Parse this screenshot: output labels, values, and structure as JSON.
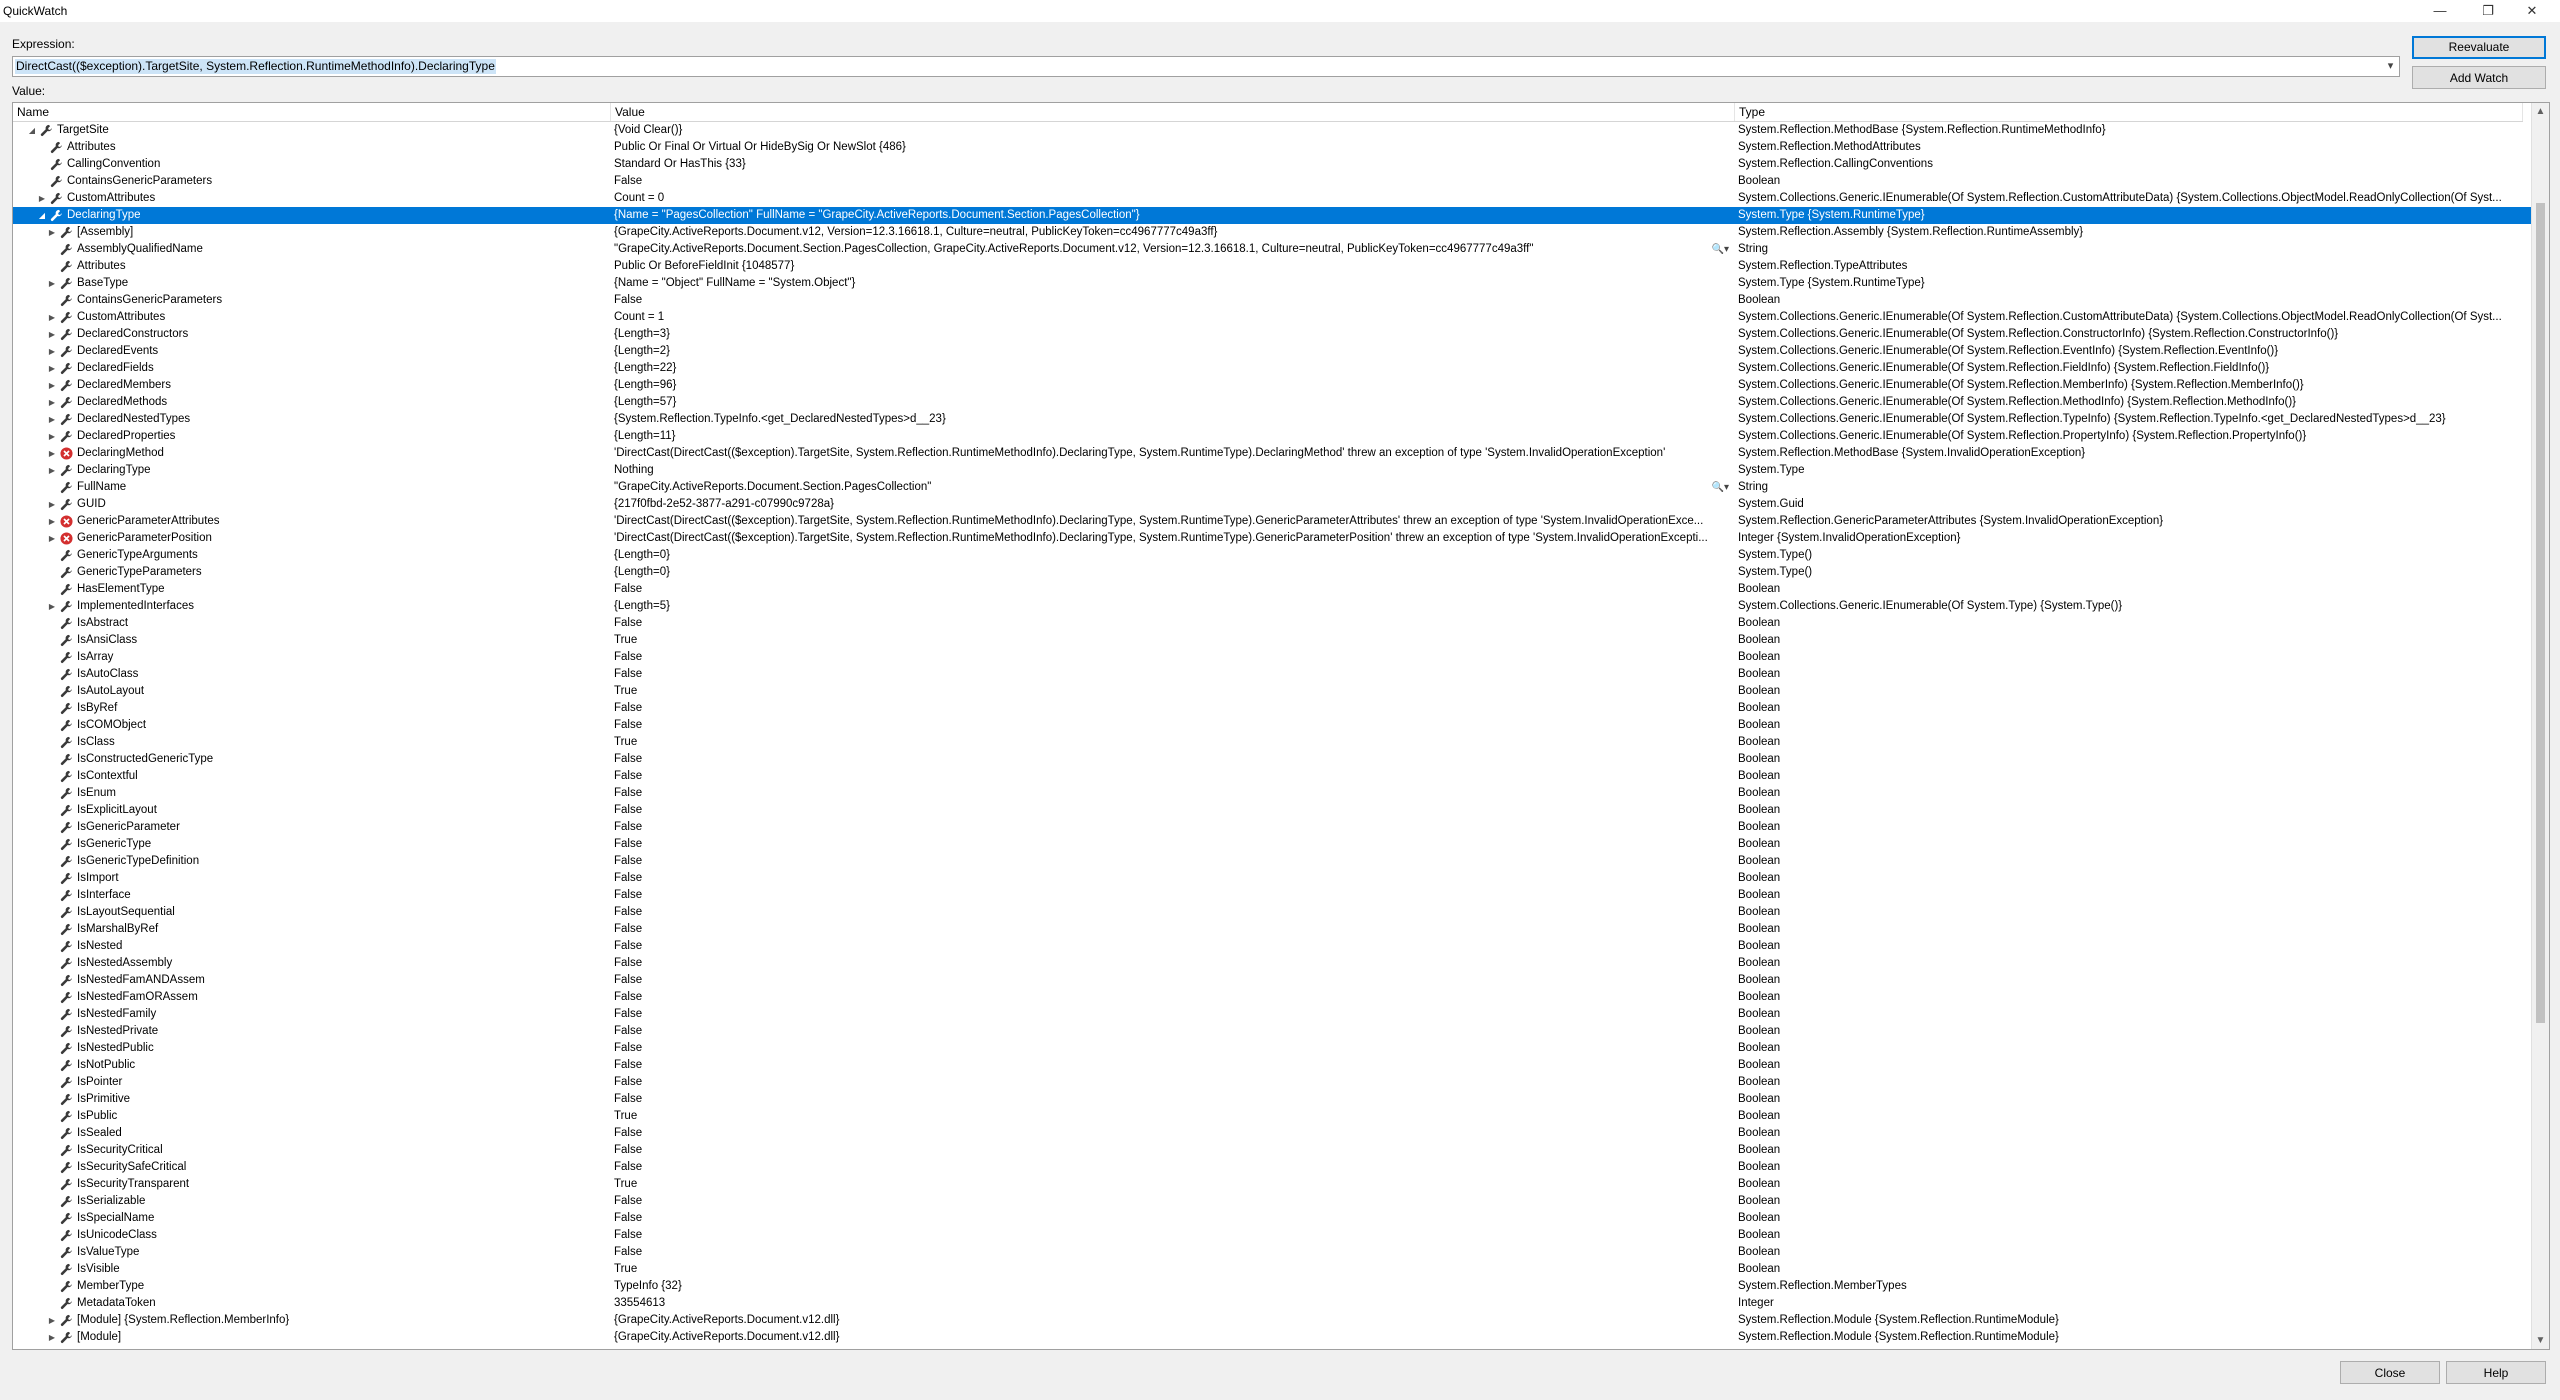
{
  "window": {
    "title": "QuickWatch",
    "controls": {
      "minimize": "—",
      "maximize": "❐",
      "close": "✕"
    }
  },
  "expression": {
    "label": "Expression:",
    "value": "DirectCast(($exception).TargetSite, System.Reflection.RuntimeMethodInfo).DeclaringType"
  },
  "value_label": "Value:",
  "buttons": {
    "reevaluate": "Reevaluate",
    "add_watch": "Add Watch",
    "close": "Close",
    "help": "Help"
  },
  "columns": {
    "name": "Name",
    "value": "Value",
    "type": "Type"
  },
  "rows": [
    {
      "level": 1,
      "exp": "collapse",
      "icon": "wrench",
      "name": "TargetSite",
      "value": "{Void Clear()}",
      "type": "System.Reflection.MethodBase {System.Reflection.RuntimeMethodInfo}"
    },
    {
      "level": 2,
      "exp": "",
      "icon": "wrench",
      "name": "Attributes",
      "value": "Public Or Final Or Virtual Or HideBySig Or NewSlot {486}",
      "type": "System.Reflection.MethodAttributes"
    },
    {
      "level": 2,
      "exp": "",
      "icon": "wrench",
      "name": "CallingConvention",
      "value": "Standard Or HasThis {33}",
      "type": "System.Reflection.CallingConventions"
    },
    {
      "level": 2,
      "exp": "",
      "icon": "wrench",
      "name": "ContainsGenericParameters",
      "value": "False",
      "type": "Boolean"
    },
    {
      "level": 2,
      "exp": "expand",
      "icon": "wrench",
      "name": "CustomAttributes",
      "value": "Count = 0",
      "type": "System.Collections.Generic.IEnumerable(Of System.Reflection.CustomAttributeData) {System.Collections.ObjectModel.ReadOnlyCollection(Of Syst..."
    },
    {
      "level": 2,
      "exp": "collapse",
      "icon": "wrench",
      "name": "DeclaringType",
      "value": "{Name = \"PagesCollection\" FullName = \"GrapeCity.ActiveReports.Document.Section.PagesCollection\"}",
      "type": "System.Type {System.RuntimeType}",
      "selected": true
    },
    {
      "level": 3,
      "exp": "expand",
      "icon": "wrench",
      "name": "[Assembly]",
      "value": "{GrapeCity.ActiveReports.Document.v12, Version=12.3.16618.1, Culture=neutral, PublicKeyToken=cc4967777c49a3ff}",
      "type": "System.Reflection.Assembly {System.Reflection.RuntimeAssembly}"
    },
    {
      "level": 3,
      "exp": "",
      "icon": "wrench",
      "name": "AssemblyQualifiedName",
      "value": "\"GrapeCity.ActiveReports.Document.Section.PagesCollection, GrapeCity.ActiveReports.Document.v12, Version=12.3.16618.1, Culture=neutral, PublicKeyToken=cc4967777c49a3ff\"",
      "type": "String",
      "mag": "🔍▾"
    },
    {
      "level": 3,
      "exp": "",
      "icon": "wrench",
      "name": "Attributes",
      "value": "Public Or BeforeFieldInit {1048577}",
      "type": "System.Reflection.TypeAttributes"
    },
    {
      "level": 3,
      "exp": "expand",
      "icon": "wrench",
      "name": "BaseType",
      "value": "{Name = \"Object\" FullName = \"System.Object\"}",
      "type": "System.Type {System.RuntimeType}"
    },
    {
      "level": 3,
      "exp": "",
      "icon": "wrench",
      "name": "ContainsGenericParameters",
      "value": "False",
      "type": "Boolean"
    },
    {
      "level": 3,
      "exp": "expand",
      "icon": "wrench",
      "name": "CustomAttributes",
      "value": "Count = 1",
      "type": "System.Collections.Generic.IEnumerable(Of System.Reflection.CustomAttributeData) {System.Collections.ObjectModel.ReadOnlyCollection(Of Syst..."
    },
    {
      "level": 3,
      "exp": "expand",
      "icon": "wrench",
      "name": "DeclaredConstructors",
      "value": "{Length=3}",
      "type": "System.Collections.Generic.IEnumerable(Of System.Reflection.ConstructorInfo) {System.Reflection.ConstructorInfo()}"
    },
    {
      "level": 3,
      "exp": "expand",
      "icon": "wrench",
      "name": "DeclaredEvents",
      "value": "{Length=2}",
      "type": "System.Collections.Generic.IEnumerable(Of System.Reflection.EventInfo) {System.Reflection.EventInfo()}"
    },
    {
      "level": 3,
      "exp": "expand",
      "icon": "wrench",
      "name": "DeclaredFields",
      "value": "{Length=22}",
      "type": "System.Collections.Generic.IEnumerable(Of System.Reflection.FieldInfo) {System.Reflection.FieldInfo()}"
    },
    {
      "level": 3,
      "exp": "expand",
      "icon": "wrench",
      "name": "DeclaredMembers",
      "value": "{Length=96}",
      "type": "System.Collections.Generic.IEnumerable(Of System.Reflection.MemberInfo) {System.Reflection.MemberInfo()}"
    },
    {
      "level": 3,
      "exp": "expand",
      "icon": "wrench",
      "name": "DeclaredMethods",
      "value": "{Length=57}",
      "type": "System.Collections.Generic.IEnumerable(Of System.Reflection.MethodInfo) {System.Reflection.MethodInfo()}"
    },
    {
      "level": 3,
      "exp": "expand",
      "icon": "wrench",
      "name": "DeclaredNestedTypes",
      "value": "{System.Reflection.TypeInfo.<get_DeclaredNestedTypes>d__23}",
      "type": "System.Collections.Generic.IEnumerable(Of System.Reflection.TypeInfo) {System.Reflection.TypeInfo.<get_DeclaredNestedTypes>d__23}"
    },
    {
      "level": 3,
      "exp": "expand",
      "icon": "wrench",
      "name": "DeclaredProperties",
      "value": "{Length=11}",
      "type": "System.Collections.Generic.IEnumerable(Of System.Reflection.PropertyInfo) {System.Reflection.PropertyInfo()}"
    },
    {
      "level": 3,
      "exp": "expand",
      "icon": "error",
      "name": "DeclaringMethod",
      "value": "'DirectCast(DirectCast(($exception).TargetSite, System.Reflection.RuntimeMethodInfo).DeclaringType, System.RuntimeType).DeclaringMethod' threw an exception of type 'System.InvalidOperationException'",
      "type": "System.Reflection.MethodBase {System.InvalidOperationException}"
    },
    {
      "level": 3,
      "exp": "expand",
      "icon": "wrench",
      "name": "DeclaringType",
      "value": "Nothing",
      "type": "System.Type"
    },
    {
      "level": 3,
      "exp": "",
      "icon": "wrench",
      "name": "FullName",
      "value": "\"GrapeCity.ActiveReports.Document.Section.PagesCollection\"",
      "type": "String",
      "mag": "🔍▾"
    },
    {
      "level": 3,
      "exp": "expand",
      "icon": "wrench",
      "name": "GUID",
      "value": "{217f0fbd-2e52-3877-a291-c07990c9728a}",
      "type": "System.Guid"
    },
    {
      "level": 3,
      "exp": "expand",
      "icon": "error",
      "name": "GenericParameterAttributes",
      "value": "'DirectCast(DirectCast(($exception).TargetSite, System.Reflection.RuntimeMethodInfo).DeclaringType, System.RuntimeType).GenericParameterAttributes' threw an exception of type 'System.InvalidOperationExce...",
      "type": "System.Reflection.GenericParameterAttributes {System.InvalidOperationException}"
    },
    {
      "level": 3,
      "exp": "expand",
      "icon": "error",
      "name": "GenericParameterPosition",
      "value": "'DirectCast(DirectCast(($exception).TargetSite, System.Reflection.RuntimeMethodInfo).DeclaringType, System.RuntimeType).GenericParameterPosition' threw an exception of type 'System.InvalidOperationExcepti...",
      "type": "Integer {System.InvalidOperationException}"
    },
    {
      "level": 3,
      "exp": "",
      "icon": "wrench",
      "name": "GenericTypeArguments",
      "value": "{Length=0}",
      "type": "System.Type()"
    },
    {
      "level": 3,
      "exp": "",
      "icon": "wrench",
      "name": "GenericTypeParameters",
      "value": "{Length=0}",
      "type": "System.Type()"
    },
    {
      "level": 3,
      "exp": "",
      "icon": "wrench",
      "name": "HasElementType",
      "value": "False",
      "type": "Boolean"
    },
    {
      "level": 3,
      "exp": "expand",
      "icon": "wrench",
      "name": "ImplementedInterfaces",
      "value": "{Length=5}",
      "type": "System.Collections.Generic.IEnumerable(Of System.Type) {System.Type()}"
    },
    {
      "level": 3,
      "exp": "",
      "icon": "wrench",
      "name": "IsAbstract",
      "value": "False",
      "type": "Boolean"
    },
    {
      "level": 3,
      "exp": "",
      "icon": "wrench",
      "name": "IsAnsiClass",
      "value": "True",
      "type": "Boolean"
    },
    {
      "level": 3,
      "exp": "",
      "icon": "wrench",
      "name": "IsArray",
      "value": "False",
      "type": "Boolean"
    },
    {
      "level": 3,
      "exp": "",
      "icon": "wrench",
      "name": "IsAutoClass",
      "value": "False",
      "type": "Boolean"
    },
    {
      "level": 3,
      "exp": "",
      "icon": "wrench",
      "name": "IsAutoLayout",
      "value": "True",
      "type": "Boolean"
    },
    {
      "level": 3,
      "exp": "",
      "icon": "wrench",
      "name": "IsByRef",
      "value": "False",
      "type": "Boolean"
    },
    {
      "level": 3,
      "exp": "",
      "icon": "wrench",
      "name": "IsCOMObject",
      "value": "False",
      "type": "Boolean"
    },
    {
      "level": 3,
      "exp": "",
      "icon": "wrench",
      "name": "IsClass",
      "value": "True",
      "type": "Boolean"
    },
    {
      "level": 3,
      "exp": "",
      "icon": "wrench",
      "name": "IsConstructedGenericType",
      "value": "False",
      "type": "Boolean"
    },
    {
      "level": 3,
      "exp": "",
      "icon": "wrench",
      "name": "IsContextful",
      "value": "False",
      "type": "Boolean"
    },
    {
      "level": 3,
      "exp": "",
      "icon": "wrench",
      "name": "IsEnum",
      "value": "False",
      "type": "Boolean"
    },
    {
      "level": 3,
      "exp": "",
      "icon": "wrench",
      "name": "IsExplicitLayout",
      "value": "False",
      "type": "Boolean"
    },
    {
      "level": 3,
      "exp": "",
      "icon": "wrench",
      "name": "IsGenericParameter",
      "value": "False",
      "type": "Boolean"
    },
    {
      "level": 3,
      "exp": "",
      "icon": "wrench",
      "name": "IsGenericType",
      "value": "False",
      "type": "Boolean"
    },
    {
      "level": 3,
      "exp": "",
      "icon": "wrench",
      "name": "IsGenericTypeDefinition",
      "value": "False",
      "type": "Boolean"
    },
    {
      "level": 3,
      "exp": "",
      "icon": "wrench",
      "name": "IsImport",
      "value": "False",
      "type": "Boolean"
    },
    {
      "level": 3,
      "exp": "",
      "icon": "wrench",
      "name": "IsInterface",
      "value": "False",
      "type": "Boolean"
    },
    {
      "level": 3,
      "exp": "",
      "icon": "wrench",
      "name": "IsLayoutSequential",
      "value": "False",
      "type": "Boolean"
    },
    {
      "level": 3,
      "exp": "",
      "icon": "wrench",
      "name": "IsMarshalByRef",
      "value": "False",
      "type": "Boolean"
    },
    {
      "level": 3,
      "exp": "",
      "icon": "wrench",
      "name": "IsNested",
      "value": "False",
      "type": "Boolean"
    },
    {
      "level": 3,
      "exp": "",
      "icon": "wrench",
      "name": "IsNestedAssembly",
      "value": "False",
      "type": "Boolean"
    },
    {
      "level": 3,
      "exp": "",
      "icon": "wrench",
      "name": "IsNestedFamANDAssem",
      "value": "False",
      "type": "Boolean"
    },
    {
      "level": 3,
      "exp": "",
      "icon": "wrench",
      "name": "IsNestedFamORAssem",
      "value": "False",
      "type": "Boolean"
    },
    {
      "level": 3,
      "exp": "",
      "icon": "wrench",
      "name": "IsNestedFamily",
      "value": "False",
      "type": "Boolean"
    },
    {
      "level": 3,
      "exp": "",
      "icon": "wrench",
      "name": "IsNestedPrivate",
      "value": "False",
      "type": "Boolean"
    },
    {
      "level": 3,
      "exp": "",
      "icon": "wrench",
      "name": "IsNestedPublic",
      "value": "False",
      "type": "Boolean"
    },
    {
      "level": 3,
      "exp": "",
      "icon": "wrench",
      "name": "IsNotPublic",
      "value": "False",
      "type": "Boolean"
    },
    {
      "level": 3,
      "exp": "",
      "icon": "wrench",
      "name": "IsPointer",
      "value": "False",
      "type": "Boolean"
    },
    {
      "level": 3,
      "exp": "",
      "icon": "wrench",
      "name": "IsPrimitive",
      "value": "False",
      "type": "Boolean"
    },
    {
      "level": 3,
      "exp": "",
      "icon": "wrench",
      "name": "IsPublic",
      "value": "True",
      "type": "Boolean"
    },
    {
      "level": 3,
      "exp": "",
      "icon": "wrench",
      "name": "IsSealed",
      "value": "False",
      "type": "Boolean"
    },
    {
      "level": 3,
      "exp": "",
      "icon": "wrench",
      "name": "IsSecurityCritical",
      "value": "False",
      "type": "Boolean"
    },
    {
      "level": 3,
      "exp": "",
      "icon": "wrench",
      "name": "IsSecuritySafeCritical",
      "value": "False",
      "type": "Boolean"
    },
    {
      "level": 3,
      "exp": "",
      "icon": "wrench",
      "name": "IsSecurityTransparent",
      "value": "True",
      "type": "Boolean"
    },
    {
      "level": 3,
      "exp": "",
      "icon": "wrench",
      "name": "IsSerializable",
      "value": "False",
      "type": "Boolean"
    },
    {
      "level": 3,
      "exp": "",
      "icon": "wrench",
      "name": "IsSpecialName",
      "value": "False",
      "type": "Boolean"
    },
    {
      "level": 3,
      "exp": "",
      "icon": "wrench",
      "name": "IsUnicodeClass",
      "value": "False",
      "type": "Boolean"
    },
    {
      "level": 3,
      "exp": "",
      "icon": "wrench",
      "name": "IsValueType",
      "value": "False",
      "type": "Boolean"
    },
    {
      "level": 3,
      "exp": "",
      "icon": "wrench",
      "name": "IsVisible",
      "value": "True",
      "type": "Boolean"
    },
    {
      "level": 3,
      "exp": "",
      "icon": "wrench",
      "name": "MemberType",
      "value": "TypeInfo {32}",
      "type": "System.Reflection.MemberTypes"
    },
    {
      "level": 3,
      "exp": "",
      "icon": "wrench",
      "name": "MetadataToken",
      "value": "33554613",
      "type": "Integer"
    },
    {
      "level": 3,
      "exp": "expand",
      "icon": "wrench",
      "name": "[Module] {System.Reflection.MemberInfo}",
      "value": "{GrapeCity.ActiveReports.Document.v12.dll}",
      "type": "System.Reflection.Module {System.Reflection.RuntimeModule}"
    },
    {
      "level": 3,
      "exp": "expand",
      "icon": "wrench",
      "name": "[Module]",
      "value": "{GrapeCity.ActiveReports.Document.v12.dll}",
      "type": "System.Reflection.Module {System.Reflection.RuntimeModule}"
    }
  ]
}
